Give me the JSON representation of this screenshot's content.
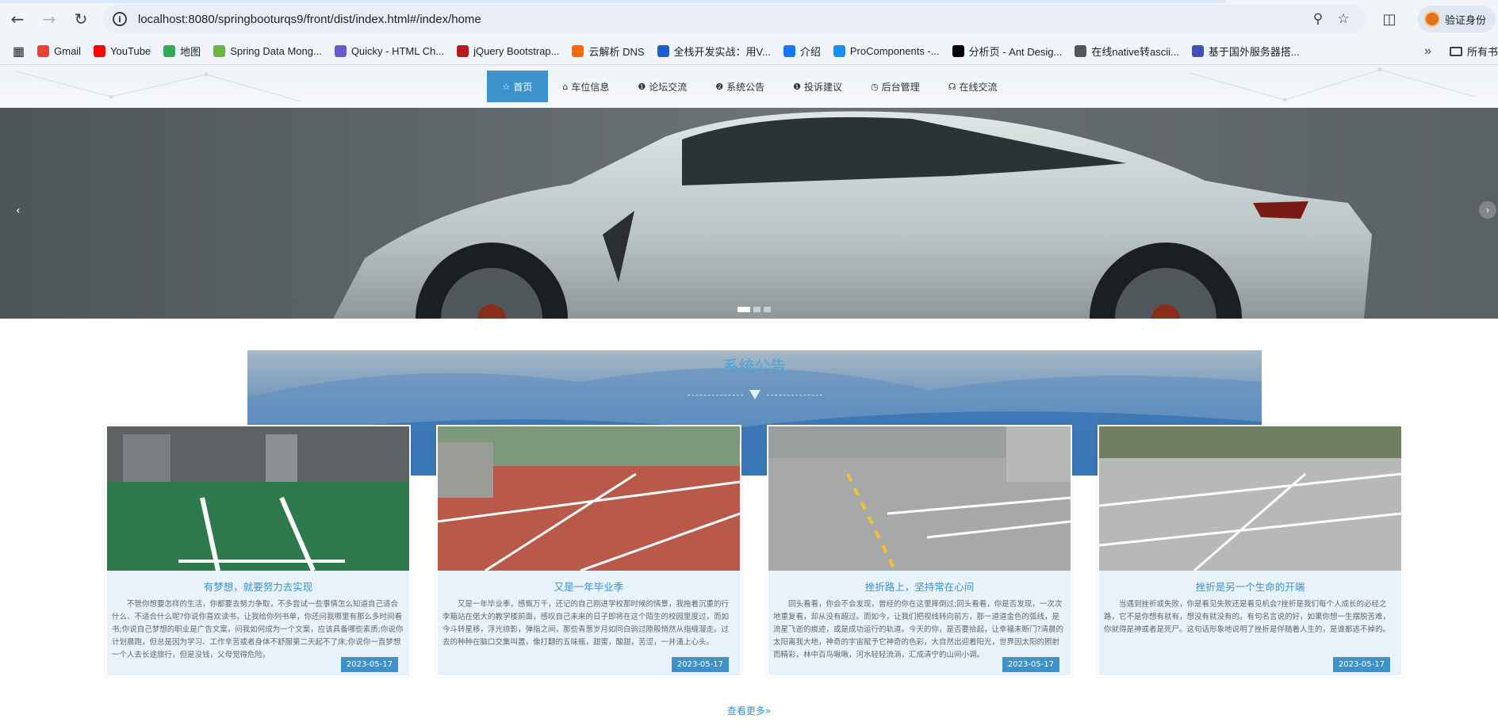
{
  "browser": {
    "url": "localhost:8080/springbooturqs9/front/dist/index.html#/index/home",
    "profile_label": "验证身份",
    "bookmarks": [
      {
        "label": "Gmail",
        "color": "#ea4335"
      },
      {
        "label": "YouTube",
        "color": "#ff0000"
      },
      {
        "label": "地图",
        "color": "#34a853"
      },
      {
        "label": "Spring Data Mong...",
        "color": "#6db33f"
      },
      {
        "label": "Quicky - HTML Ch...",
        "color": "#6a5acd"
      },
      {
        "label": "jQuery Bootstrap...",
        "color": "#b71c1c"
      },
      {
        "label": "云解析 DNS",
        "color": "#ff6a00"
      },
      {
        "label": "全栈开发实战：用V...",
        "color": "#1e5bd6"
      },
      {
        "label": "介绍",
        "color": "#1677ff"
      },
      {
        "label": "ProComponents -...",
        "color": "#1890ff"
      },
      {
        "label": "分析页 - Ant Desig...",
        "color": "#000000"
      },
      {
        "label": "在线native转ascii...",
        "color": "#555555"
      },
      {
        "label": "基于国外服务器搭...",
        "color": "#3f51b5"
      }
    ],
    "bookmarks_folder": "所有书"
  },
  "site_nav": {
    "items": [
      {
        "label": "首页",
        "icon": "☆",
        "active": true
      },
      {
        "label": "车位信息",
        "icon": "⌂",
        "active": false
      },
      {
        "label": "论坛交流",
        "icon": "❶",
        "active": false
      },
      {
        "label": "系统公告",
        "icon": "❷",
        "active": false
      },
      {
        "label": "投诉建议",
        "icon": "❶",
        "active": false
      },
      {
        "label": "后台管理",
        "icon": "◷",
        "active": false
      },
      {
        "label": "在线交流",
        "icon": "☊",
        "active": false
      }
    ]
  },
  "carousel": {
    "slide_count": 3,
    "active_slide": 1
  },
  "notice": {
    "title": "系统公告",
    "cards": [
      {
        "title": "有梦想，就要努力去实现",
        "body": "不管你想要怎样的生活，你都要去努力争取，不多尝试一些事情怎么知道自己适合什么、不适合什么呢?你说你喜欢读书，让我给你列书单，你还问我哪里有那么多时间看书;你说自己梦想的职业是广告文案，问我如何成为一个文案，应该具备哪些素质;你说你计划晨跑，但总是因为学习、工作辛苦或者身体不舒服第二天起不了床;你说你一直梦想一个人去长途旅行，但是没钱，父母觉得危险。",
        "date": "2023-05-17"
      },
      {
        "title": "又是一年毕业季",
        "body": "又是一年毕业季，感慨万千，还记的自己刚进学校那时候的情景，我拖着沉重的行李箱站在偌大的教学楼前面，感叹自己未来的日子即将在这个陌生的校园里度过，而如今斗转星移，浮光掠影，弹指之间，那些青葱岁月如同白驹过隙般悄然从指缝溜走。过去的种种在脑口交集叫嚣，像打翻的五味瓶，甜蜜，酸甜，苦涩，一并涌上心头。",
        "date": "2023-05-17"
      },
      {
        "title": "挫折路上，坚持常在心间",
        "body": "回头看看，你会不会发现，曾经的你在这里摔倒过;回头看看，你是否发现，一次次地重复看，却从没有超过。而如今，让我们把视线转向前方，那一道道金色的弧线，是流星飞逝的痕迹，或是成功运行的轨道。今天的你，是否要拾起，让幸福未断门?清晨的太阳离我大地，神奇的宇宙赋予它神奇的色彩，大自然出迎着阳光，世界因太阳的照射而精彩，林中百鸟啾啾，河水轻轻流淌，汇成清宁的山间小调。",
        "date": "2023-05-17"
      },
      {
        "title": "挫折是另一个生命的开端",
        "body": "当遇到挫折或失败，你是看见失败还是看见机会?挫折是我们每个人成长的必经之路，它不是你想有就有，想没有就没有的。有句名言说的好，如果你想一生摆脱苦难，你就得是神或者是死尸。这句话形象地说明了挫折是伴随着人生的，是谁都逃不掉的。",
        "date": "2023-05-17"
      }
    ],
    "more_label": "查看更多»"
  }
}
